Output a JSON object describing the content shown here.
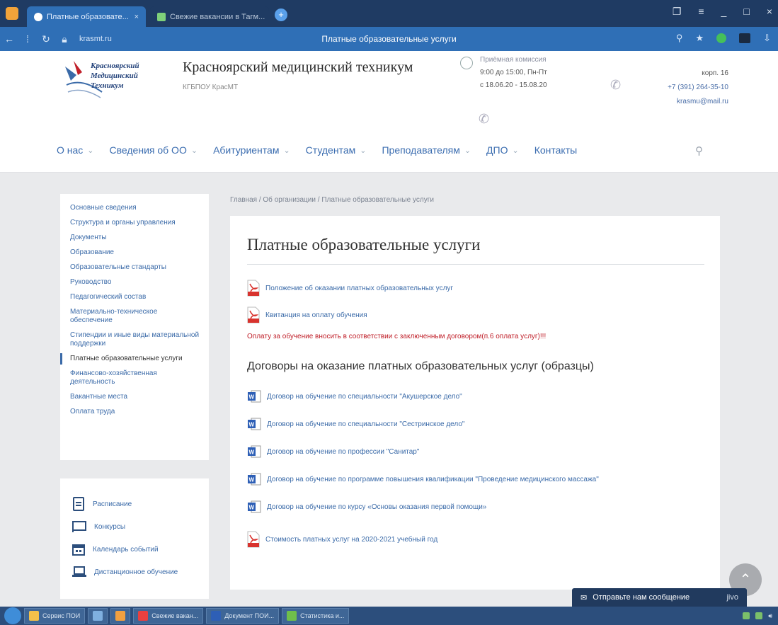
{
  "browser": {
    "tabs": [
      {
        "label": "Платные образовате...",
        "active": true
      },
      {
        "label": "Свежие вакансии в Тагм...",
        "active": false
      }
    ],
    "url": "krasmt.ru",
    "page_title": "Платные образовательные услуги"
  },
  "site": {
    "logo_lines": [
      "Красноярский",
      "Медицинский",
      "Техникум"
    ],
    "name": "Красноярский медицинский техникум",
    "abbr": "КГБПОУ КрасМТ",
    "hours": {
      "label": "Приёмная комиссия",
      "time": "9:00 до 15:00, Пн-Пт",
      "dates": "с 18.06.20 - 15.08.20"
    },
    "contacts": {
      "address": "корп. 16",
      "phone": "+7 (391) 264-35-10",
      "email": "krasmu@mail.ru"
    }
  },
  "menu": [
    {
      "label": "О нас",
      "has_sub": true
    },
    {
      "label": "Сведения об ОО",
      "has_sub": true
    },
    {
      "label": "Абитуриентам",
      "has_sub": true
    },
    {
      "label": "Студентам",
      "has_sub": true
    },
    {
      "label": "Преподавателям",
      "has_sub": true
    },
    {
      "label": "ДПО",
      "has_sub": true
    },
    {
      "label": "Контакты",
      "has_sub": false
    }
  ],
  "sidebar": {
    "items": [
      "Основные сведения",
      "Структура и органы управления",
      "Документы",
      "Образование",
      "Образовательные стандарты",
      "Руководство",
      "Педагогический состав",
      "Материально-техническое обеспечение",
      "Стипендии и иные виды материальной поддержки",
      "Платные образовательные услуги",
      "Финансово-хозяйственная деятельность",
      "Вакантные места",
      "Оплата труда"
    ],
    "active_index": 9
  },
  "quick_links": [
    {
      "label": "Расписание",
      "icon": "document-icon"
    },
    {
      "label": "Конкурсы",
      "icon": "flag-icon"
    },
    {
      "label": "Календарь событий",
      "icon": "calendar-icon"
    },
    {
      "label": "Дистанционное обучение",
      "icon": "laptop-icon"
    }
  ],
  "breadcrumb": [
    "Главная",
    "Об организации",
    "Платные образовательные услуги"
  ],
  "content": {
    "title": "Платные образовательные услуги",
    "pdf_links": [
      "Положение об оказании платных образовательных услуг",
      "Квитанция на оплату обучения"
    ],
    "notice": "Оплату за обучение вносить в соответствии с заключенным договором(п.6 оплата услуг)!!!",
    "subtitle": "Договоры на оказание платных образовательных услуг (образцы)",
    "word_links": [
      "Договор на обучение по специальности \"Акушерское дело\"",
      "Договор на обучение по специальности \"Сестринское дело\"",
      "Договор на обучение по профессии \"Санитар\"",
      "Договор на обучение по программе повышения квалификации \"Проведение медицинского массажа\"",
      "Договор на обучение по курсу «Основы оказания первой помощи»"
    ],
    "last_pdf": "Стоимость платных услуг на 2020-2021 учебный год"
  },
  "chat": {
    "label": "Отправьте нам сообщение",
    "brand": "jivo"
  },
  "taskbar": [
    {
      "label": "Сервис ПОИ",
      "color": "#f3c04a"
    },
    {
      "label": "",
      "color": "#7fb0e0"
    },
    {
      "label": "",
      "color": "#f0a040"
    },
    {
      "label": "Свежие вакан...",
      "color": "#e94040"
    },
    {
      "label": "Документ ПОИ...",
      "color": "#2e5fb6"
    },
    {
      "label": "Статистика и...",
      "color": "#6fbf4a"
    }
  ],
  "colors": {
    "accent": "#3a6aa8",
    "notice": "#c0202a",
    "browser": "#2f6fb6"
  }
}
